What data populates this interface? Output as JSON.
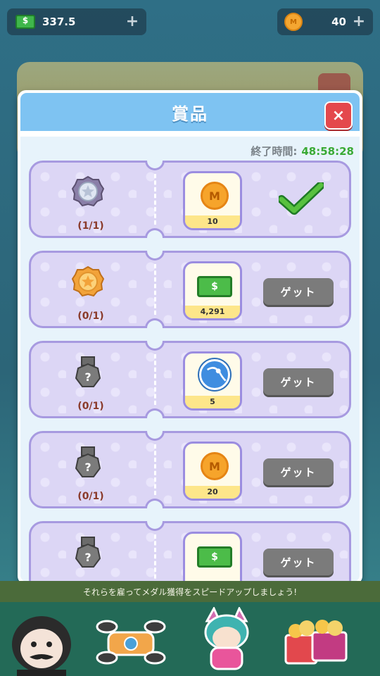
{
  "header": {
    "cash_value": "337.5",
    "coin_value": "40",
    "cash_icon": "cash-icon",
    "coin_icon": "coin-icon",
    "coin_letter": "M"
  },
  "modal": {
    "title": "賞品",
    "close_label": "×",
    "timer_label": "終了時間:",
    "timer_value": "48:58:28"
  },
  "rewards": [
    {
      "medal": "silver-medal",
      "count": "(1/1)",
      "reward_type": "coin",
      "reward_glyph": "M",
      "reward_amount": "10",
      "status": "claimed"
    },
    {
      "medal": "gold-medal",
      "count": "(0/1)",
      "reward_type": "cash",
      "reward_glyph": "$",
      "reward_amount": "4,291",
      "status": "get",
      "button_label": "ゲット"
    },
    {
      "medal": "locked-medal",
      "count": "(0/1)",
      "reward_type": "ball",
      "reward_amount": "5",
      "status": "get",
      "button_label": "ゲット"
    },
    {
      "medal": "locked-medal",
      "count": "(0/1)",
      "reward_type": "coin",
      "reward_glyph": "M",
      "reward_amount": "20",
      "status": "get",
      "button_label": "ゲット"
    },
    {
      "medal": "locked-medal",
      "reward_type": "cash",
      "reward_glyph": "$",
      "status": "get",
      "button_label": "ゲット"
    }
  ],
  "banner_text": "それらを雇ってメダル獲得をスピードアップしましょう!",
  "colors": {
    "accent_header": "#7ec3f2",
    "close": "#e4484c",
    "timer": "#3aaa35",
    "button": "#7b7b7b",
    "card": "#dcd6f5"
  }
}
